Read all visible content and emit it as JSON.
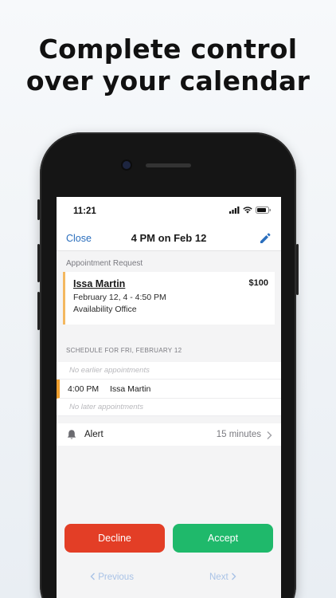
{
  "headline": {
    "line1": "Complete control",
    "line2": "over your calendar"
  },
  "status_bar": {
    "time": "11:21",
    "icons": [
      "signal-icon",
      "wifi-icon",
      "battery-icon"
    ]
  },
  "nav": {
    "close_label": "Close",
    "title": "4 PM on Feb 12",
    "edit_icon": "pencil-icon"
  },
  "request": {
    "section_label": "Appointment Request",
    "name": "Issa Martin",
    "price": "$100",
    "datetime": "February 12, 4 - 4:50 PM",
    "location": "Availability Office"
  },
  "schedule": {
    "header": "SCHEDULE FOR FRI, FEBRUARY 12",
    "earlier": "No earlier appointments",
    "item_time": "4:00 PM",
    "item_name": "Issa Martin",
    "later": "No later appointments"
  },
  "alert": {
    "label": "Alert",
    "value": "15 minutes"
  },
  "actions": {
    "decline": "Decline",
    "accept": "Accept"
  },
  "pager": {
    "previous": "Previous",
    "next": "Next"
  },
  "colors": {
    "link": "#2a6ebd",
    "decline": "#e33e26",
    "accept": "#1fb96b",
    "pending_accent": "#f4b860"
  }
}
